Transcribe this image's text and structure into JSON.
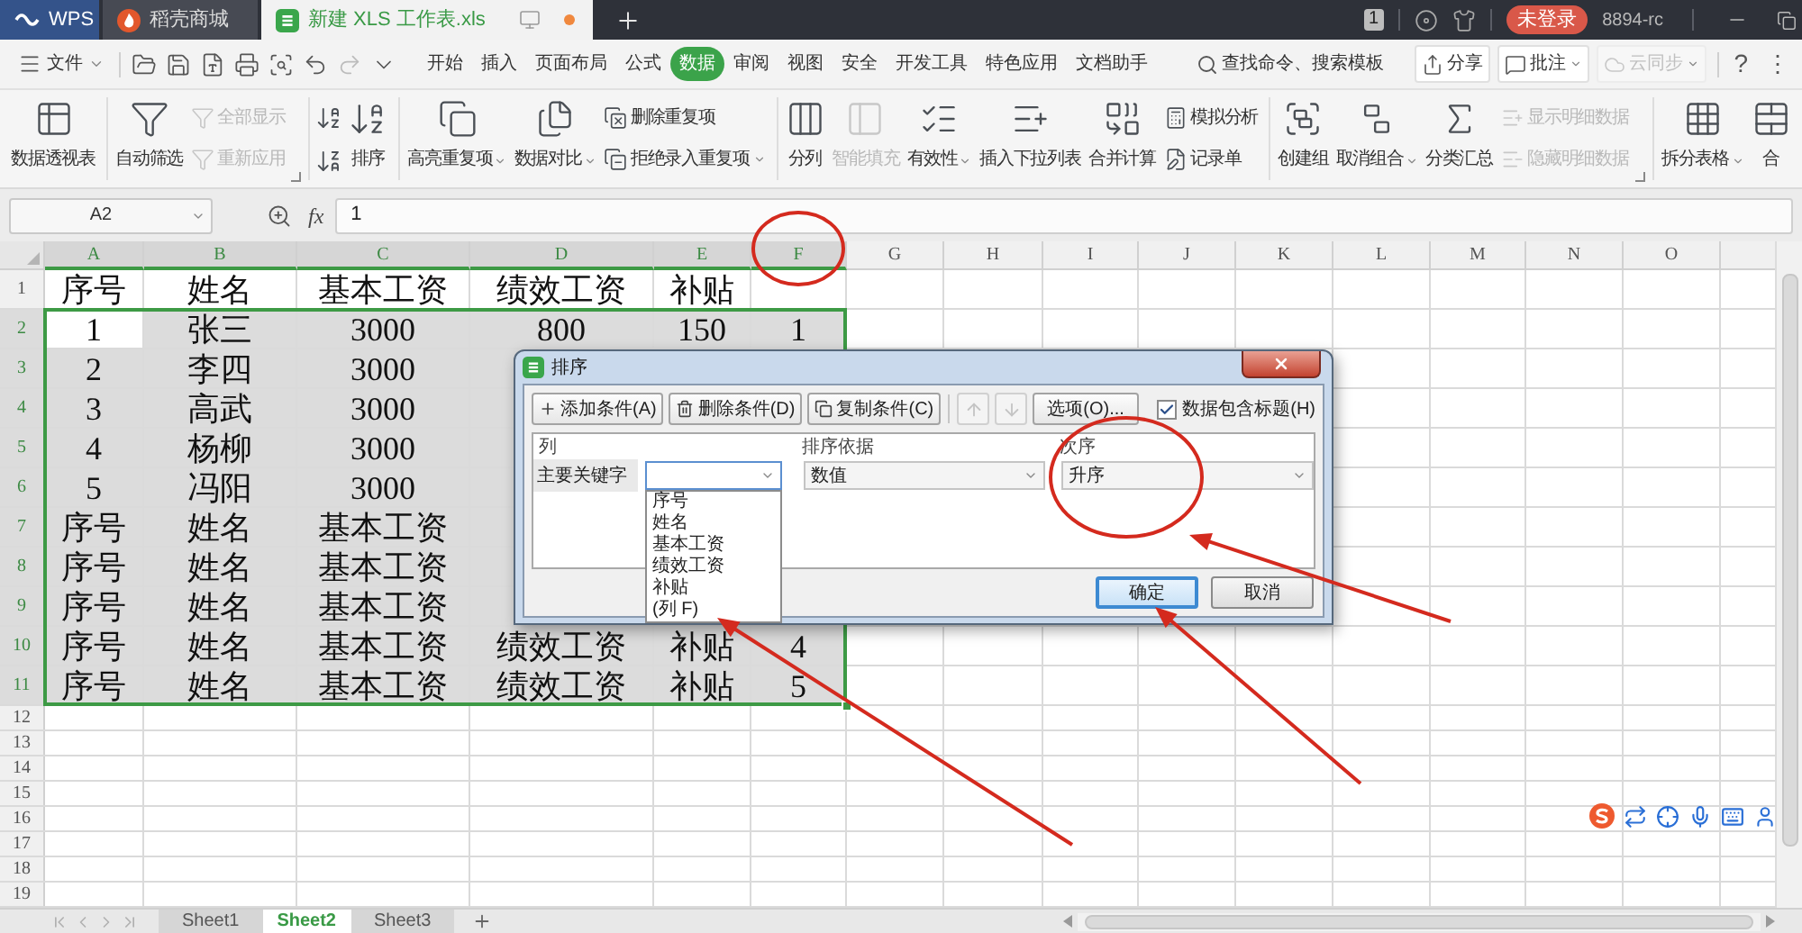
{
  "title_bar": {
    "tabs": [
      {
        "label": "WPS",
        "kind": "home",
        "selected": false
      },
      {
        "label": "稻壳商城",
        "kind": "store",
        "selected": false
      },
      {
        "label": "新建 XLS 工作表.xls",
        "kind": "document",
        "selected": true
      }
    ],
    "badge": "1",
    "login_button": "未登录",
    "user": "8894-rc"
  },
  "menu_bar": {
    "file_menu": "文件",
    "tabs": [
      {
        "label": "开始",
        "selected": false
      },
      {
        "label": "插入",
        "selected": false
      },
      {
        "label": "页面布局",
        "selected": false
      },
      {
        "label": "公式",
        "selected": false
      },
      {
        "label": "数据",
        "selected": true
      },
      {
        "label": "审阅",
        "selected": false
      },
      {
        "label": "视图",
        "selected": false
      },
      {
        "label": "安全",
        "selected": false
      },
      {
        "label": "开发工具",
        "selected": false
      },
      {
        "label": "特色应用",
        "selected": false
      },
      {
        "label": "文档助手",
        "selected": false
      }
    ],
    "search": {
      "placeholder": "查找命令、搜索模板"
    },
    "buttons": [
      {
        "label": "分享",
        "dropdown": false,
        "disabled": false
      },
      {
        "label": "批注",
        "dropdown": true,
        "disabled": false
      },
      {
        "label": "云同步",
        "dropdown": true,
        "disabled": true
      }
    ],
    "help": "?",
    "more": "⋮"
  },
  "ribbon": {
    "groups": [
      {
        "launcher": false,
        "items": [
          {
            "kind": "large",
            "label": "数据透视表",
            "disabled": false,
            "dropdown": false
          }
        ]
      },
      {
        "launcher": true,
        "items": [
          {
            "kind": "large",
            "label": "自动筛选",
            "disabled": false,
            "dropdown": false
          },
          {
            "kind": "stack",
            "entries": [
              {
                "label": "全部显示",
                "disabled": true,
                "dropdown": false
              },
              {
                "label": "重新应用",
                "disabled": true,
                "dropdown": false
              }
            ]
          }
        ]
      },
      {
        "launcher": false,
        "items": [
          {
            "kind": "sort_icons"
          },
          {
            "kind": "large",
            "label": "排序",
            "disabled": false,
            "dropdown": false
          }
        ]
      },
      {
        "launcher": false,
        "items": [
          {
            "kind": "large",
            "label": "高亮重复项",
            "disabled": false,
            "dropdown": true
          },
          {
            "kind": "large",
            "label": "数据对比",
            "disabled": false,
            "dropdown": true
          },
          {
            "kind": "stack",
            "entries": [
              {
                "label": "删除重复项",
                "disabled": false,
                "dropdown": false
              },
              {
                "label": "拒绝录入重复项",
                "disabled": false,
                "dropdown": true
              }
            ]
          }
        ]
      },
      {
        "launcher": false,
        "items": [
          {
            "kind": "large",
            "label": "分列",
            "disabled": false,
            "dropdown": false
          },
          {
            "kind": "large",
            "label": "智能填充",
            "disabled": true,
            "dropdown": false
          },
          {
            "kind": "large",
            "label": "有效性",
            "disabled": false,
            "dropdown": true
          },
          {
            "kind": "large",
            "label": "插入下拉列表",
            "disabled": false,
            "dropdown": false
          },
          {
            "kind": "large",
            "label": "合并计算",
            "disabled": false,
            "dropdown": false
          },
          {
            "kind": "stack",
            "entries": [
              {
                "label": "模拟分析",
                "disabled": false,
                "dropdown": false
              },
              {
                "label": "记录单",
                "disabled": false,
                "dropdown": false
              }
            ]
          }
        ]
      },
      {
        "launcher": true,
        "items": [
          {
            "kind": "large",
            "label": "创建组",
            "disabled": false,
            "dropdown": false
          },
          {
            "kind": "large",
            "label": "取消组合",
            "disabled": false,
            "dropdown": true
          },
          {
            "kind": "large",
            "label": "分类汇总",
            "disabled": false,
            "dropdown": false
          },
          {
            "kind": "stack",
            "entries": [
              {
                "label": "显示明细数据",
                "disabled": true,
                "dropdown": false
              },
              {
                "label": "隐藏明细数据",
                "disabled": true,
                "dropdown": false
              }
            ]
          }
        ]
      },
      {
        "launcher": false,
        "items": [
          {
            "kind": "large",
            "label": "拆分表格",
            "disabled": false,
            "dropdown": true
          },
          {
            "kind": "large",
            "label": "合",
            "disabled": false,
            "dropdown": false
          }
        ]
      }
    ]
  },
  "formula_bar": {
    "name_box": "A2",
    "function_label": "fx",
    "value": "1"
  },
  "sheet": {
    "columns": [
      {
        "label": "A",
        "selected": true
      },
      {
        "label": "B",
        "selected": true
      },
      {
        "label": "C",
        "selected": true
      },
      {
        "label": "D",
        "selected": true
      },
      {
        "label": "E",
        "selected": true
      },
      {
        "label": "F",
        "selected": true
      },
      {
        "label": "G",
        "selected": false
      },
      {
        "label": "H",
        "selected": false
      },
      {
        "label": "I",
        "selected": false
      },
      {
        "label": "J",
        "selected": false
      },
      {
        "label": "K",
        "selected": false
      },
      {
        "label": "L",
        "selected": false
      },
      {
        "label": "M",
        "selected": false
      },
      {
        "label": "N",
        "selected": false
      },
      {
        "label": "O",
        "selected": false
      }
    ],
    "rows": [
      {
        "header": "1",
        "selected": false,
        "cells": [
          {
            "text": "序号",
            "active": false
          },
          {
            "text": "姓名",
            "active": false
          },
          {
            "text": "基本工资",
            "active": false
          },
          {
            "text": "绩效工资",
            "active": false
          },
          {
            "text": "补贴",
            "active": false
          }
        ]
      },
      {
        "header": "2",
        "selected": true,
        "cells": [
          {
            "text": "1",
            "active": true
          },
          {
            "text": "张三",
            "active": false
          },
          {
            "text": "3000",
            "active": false
          },
          {
            "text": "800",
            "active": false
          },
          {
            "text": "150",
            "active": false
          },
          {
            "text": "1",
            "active": false
          }
        ]
      },
      {
        "header": "3",
        "selected": true,
        "cells": [
          {
            "text": "2",
            "active": false
          },
          {
            "text": "李四",
            "active": false
          },
          {
            "text": "3000",
            "active": false
          }
        ]
      },
      {
        "header": "4",
        "selected": true,
        "cells": [
          {
            "text": "3",
            "active": false
          },
          {
            "text": "高武",
            "active": false
          },
          {
            "text": "3000",
            "active": false
          }
        ]
      },
      {
        "header": "5",
        "selected": true,
        "cells": [
          {
            "text": "4",
            "active": false
          },
          {
            "text": "杨柳",
            "active": false
          },
          {
            "text": "3000",
            "active": false
          }
        ]
      },
      {
        "header": "6",
        "selected": true,
        "cells": [
          {
            "text": "5",
            "active": false
          },
          {
            "text": "冯阳",
            "active": false
          },
          {
            "text": "3000",
            "active": false
          }
        ]
      },
      {
        "header": "7",
        "selected": true,
        "cells": [
          {
            "text": "序号",
            "active": false
          },
          {
            "text": "姓名",
            "active": false
          },
          {
            "text": "基本工资",
            "active": false
          }
        ]
      },
      {
        "header": "8",
        "selected": true,
        "cells": [
          {
            "text": "序号",
            "active": false
          },
          {
            "text": "姓名",
            "active": false
          },
          {
            "text": "基本工资",
            "active": false
          }
        ]
      },
      {
        "header": "9",
        "selected": true,
        "cells": [
          {
            "text": "序号",
            "active": false
          },
          {
            "text": "姓名",
            "active": false
          },
          {
            "text": "基本工资",
            "active": false
          }
        ]
      },
      {
        "header": "10",
        "selected": true,
        "cells": [
          {
            "text": "序号",
            "active": false
          },
          {
            "text": "姓名",
            "active": false
          },
          {
            "text": "基本工资",
            "active": false
          },
          {
            "text": "绩效工资",
            "active": false
          },
          {
            "text": "补贴",
            "active": false
          },
          {
            "text": "4",
            "active": false
          }
        ]
      },
      {
        "header": "11",
        "selected": true,
        "cells": [
          {
            "text": "序号",
            "active": false
          },
          {
            "text": "姓名",
            "active": false
          },
          {
            "text": "基本工资",
            "active": false
          },
          {
            "text": "绩效工资",
            "active": false
          },
          {
            "text": "补贴",
            "active": false
          },
          {
            "text": "5",
            "active": false
          }
        ]
      },
      {
        "header": "12",
        "selected": false
      },
      {
        "header": "13",
        "selected": false
      },
      {
        "header": "14",
        "selected": false
      },
      {
        "header": "15",
        "selected": false
      },
      {
        "header": "16",
        "selected": false
      },
      {
        "header": "17",
        "selected": false
      },
      {
        "header": "18",
        "selected": false
      },
      {
        "header": "19",
        "selected": false
      }
    ]
  },
  "sheet_tabs": [
    {
      "label": "Sheet1",
      "selected": false
    },
    {
      "label": "Sheet2",
      "selected": true
    },
    {
      "label": "Sheet3",
      "selected": false
    }
  ],
  "sort_dialog": {
    "title": "排序",
    "toolbar": [
      {
        "kind": "labeled",
        "label": "添加条件(A)",
        "disabled": false
      },
      {
        "kind": "labeled",
        "label": "删除条件(D)",
        "disabled": false
      },
      {
        "kind": "labeled",
        "label": "复制条件(C)",
        "disabled": false
      },
      {
        "kind": "icon",
        "disabled": true
      },
      {
        "kind": "icon",
        "disabled": true
      },
      {
        "kind": "plain",
        "label": "选项(O)...",
        "disabled": false
      }
    ],
    "header_checkbox": {
      "label": "数据包含标题(H)",
      "checked": true
    },
    "columns": [
      "列",
      "排序依据",
      "次序"
    ],
    "condition": {
      "label": "主要关键字",
      "key_expanded": true,
      "key_options": [
        "序号",
        "姓名",
        "基本工资",
        "绩效工资",
        "补贴",
        "(列 F)"
      ],
      "basis": "数值",
      "order": "升序"
    },
    "buttons": [
      {
        "label": "确定",
        "default": true
      },
      {
        "label": "取消",
        "default": false
      }
    ]
  }
}
